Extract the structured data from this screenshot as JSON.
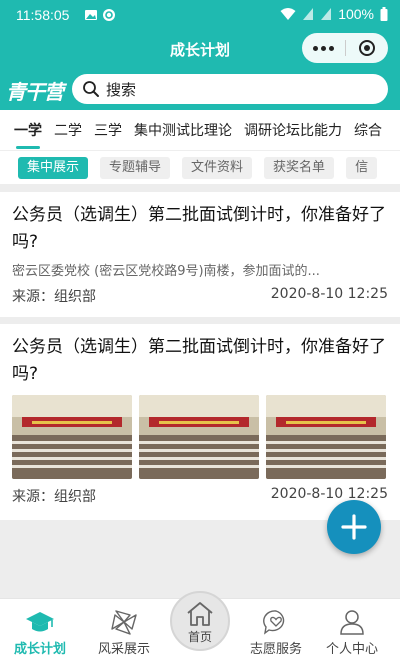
{
  "status_bar": {
    "time": "11:58:05",
    "battery": "100%"
  },
  "header": {
    "title": "成长计划",
    "logo_text": "青干营"
  },
  "search": {
    "placeholder": "搜索"
  },
  "tabs": [
    {
      "label": "一学",
      "active": true
    },
    {
      "label": "二学",
      "active": false
    },
    {
      "label": "三学",
      "active": false
    },
    {
      "label": "集中测试比理论",
      "active": false
    },
    {
      "label": "调研论坛比能力",
      "active": false
    },
    {
      "label": "综合",
      "active": false
    }
  ],
  "subtabs": [
    {
      "label": "集中展示",
      "active": true
    },
    {
      "label": "专题辅导",
      "active": false
    },
    {
      "label": "文件资料",
      "active": false
    },
    {
      "label": "获奖名单",
      "active": false
    },
    {
      "label": "信",
      "active": false
    }
  ],
  "articles": [
    {
      "title": "公务员（选调生）第二批面试倒计时，你准备好了吗?",
      "summary": "密云区委党校 (密云区党校路9号)南楼，参加面试的...",
      "source": "来源：组织部",
      "date": "2020-8-10 12:25"
    },
    {
      "title": "公务员（选调生）第二批面试倒计时，你准备好了吗?",
      "source": "来源：组织部",
      "date": "2020-8-10 12:25",
      "photo_count": 3
    }
  ],
  "bottom_nav": [
    {
      "label": "成长计划",
      "icon": "graduation-cap-icon",
      "active": true
    },
    {
      "label": "风采展示",
      "icon": "pinwheel-icon",
      "active": false
    },
    {
      "label": "首页",
      "icon": "home-icon",
      "active": false
    },
    {
      "label": "志愿服务",
      "icon": "heart-chat-icon",
      "active": false
    },
    {
      "label": "个人中心",
      "icon": "person-icon",
      "active": false
    }
  ],
  "colors": {
    "accent": "#1fbab0",
    "fab": "#1590bd"
  }
}
